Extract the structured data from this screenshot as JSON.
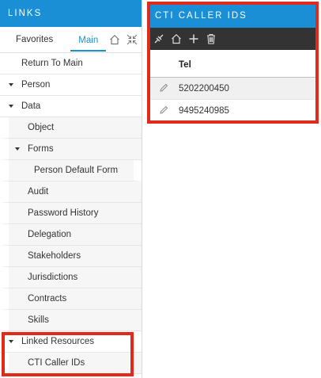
{
  "links": {
    "title": "LINKS",
    "tabs": [
      {
        "label": "Favorites"
      },
      {
        "label": "Main"
      }
    ],
    "tree": [
      {
        "label": "Return To Main"
      },
      {
        "label": "Person"
      },
      {
        "label": "Data"
      },
      {
        "label": "Object"
      },
      {
        "label": "Forms"
      },
      {
        "label": "Person Default Form"
      },
      {
        "label": "Audit"
      },
      {
        "label": "Password History"
      },
      {
        "label": "Delegation"
      },
      {
        "label": "Stakeholders"
      },
      {
        "label": "Jurisdictions"
      },
      {
        "label": "Contracts"
      },
      {
        "label": "Skills"
      },
      {
        "label": "Linked Resources"
      },
      {
        "label": "CTI Caller IDs"
      }
    ]
  },
  "cti": {
    "title": "CTI CALLER IDS",
    "column_header": "Tel",
    "rows": [
      {
        "tel": "5202200450"
      },
      {
        "tel": "9495240985"
      }
    ]
  },
  "colors": {
    "accent": "#1a8fd6",
    "toolbar": "#333333",
    "highlight": "#e02a1c"
  }
}
